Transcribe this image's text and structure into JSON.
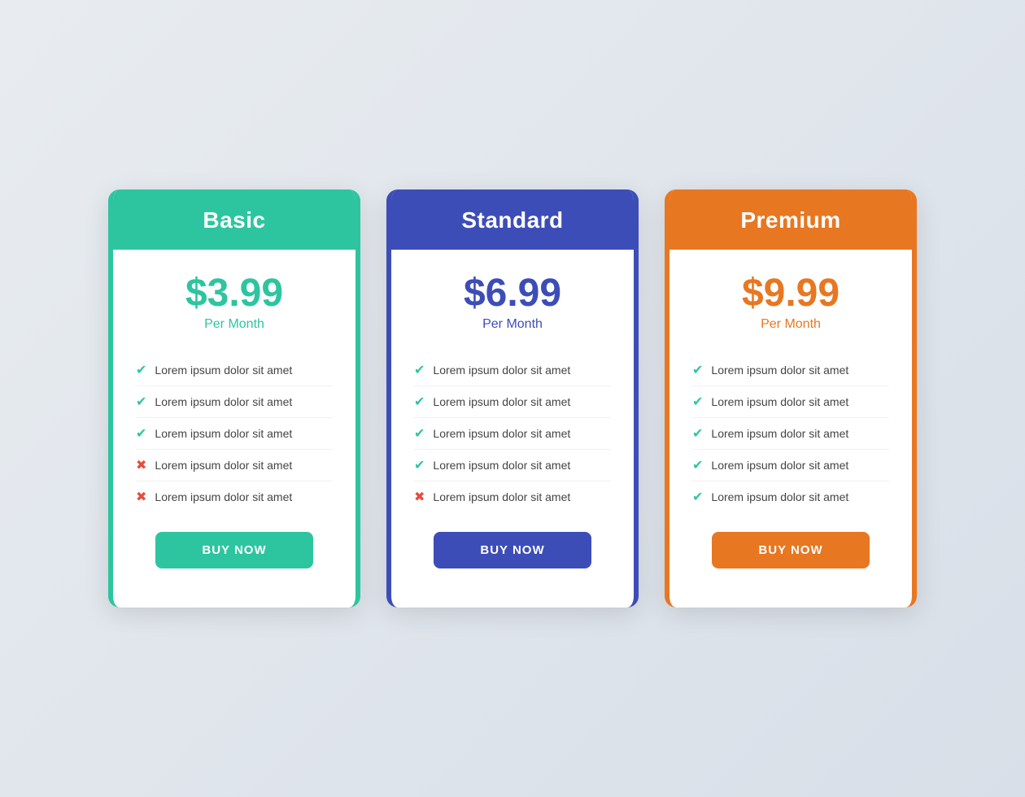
{
  "plans": [
    {
      "id": "basic",
      "name": "Basic",
      "price": "$3.99",
      "per_month": "Per Month",
      "features": [
        {
          "text": "Lorem ipsum dolor sit amet",
          "included": true
        },
        {
          "text": "Lorem ipsum dolor sit amet",
          "included": true
        },
        {
          "text": "Lorem ipsum dolor sit amet",
          "included": true
        },
        {
          "text": "Lorem ipsum dolor sit amet",
          "included": false
        },
        {
          "text": "Lorem ipsum dolor sit amet",
          "included": false
        }
      ],
      "button_label": "BUY NOW"
    },
    {
      "id": "standard",
      "name": "Standard",
      "price": "$6.99",
      "per_month": "Per Month",
      "features": [
        {
          "text": "Lorem ipsum dolor sit amet",
          "included": true
        },
        {
          "text": "Lorem ipsum dolor sit amet",
          "included": true
        },
        {
          "text": "Lorem ipsum dolor sit amet",
          "included": true
        },
        {
          "text": "Lorem ipsum dolor sit amet",
          "included": true
        },
        {
          "text": "Lorem ipsum dolor sit amet",
          "included": false
        }
      ],
      "button_label": "BUY NOW"
    },
    {
      "id": "premium",
      "name": "Premium",
      "price": "$9.99",
      "per_month": "Per Month",
      "features": [
        {
          "text": "Lorem ipsum dolor sit amet",
          "included": true
        },
        {
          "text": "Lorem ipsum dolor sit amet",
          "included": true
        },
        {
          "text": "Lorem ipsum dolor sit amet",
          "included": true
        },
        {
          "text": "Lorem ipsum dolor sit amet",
          "included": true
        },
        {
          "text": "Lorem ipsum dolor sit amet",
          "included": true
        }
      ],
      "button_label": "BUY NOW"
    }
  ]
}
